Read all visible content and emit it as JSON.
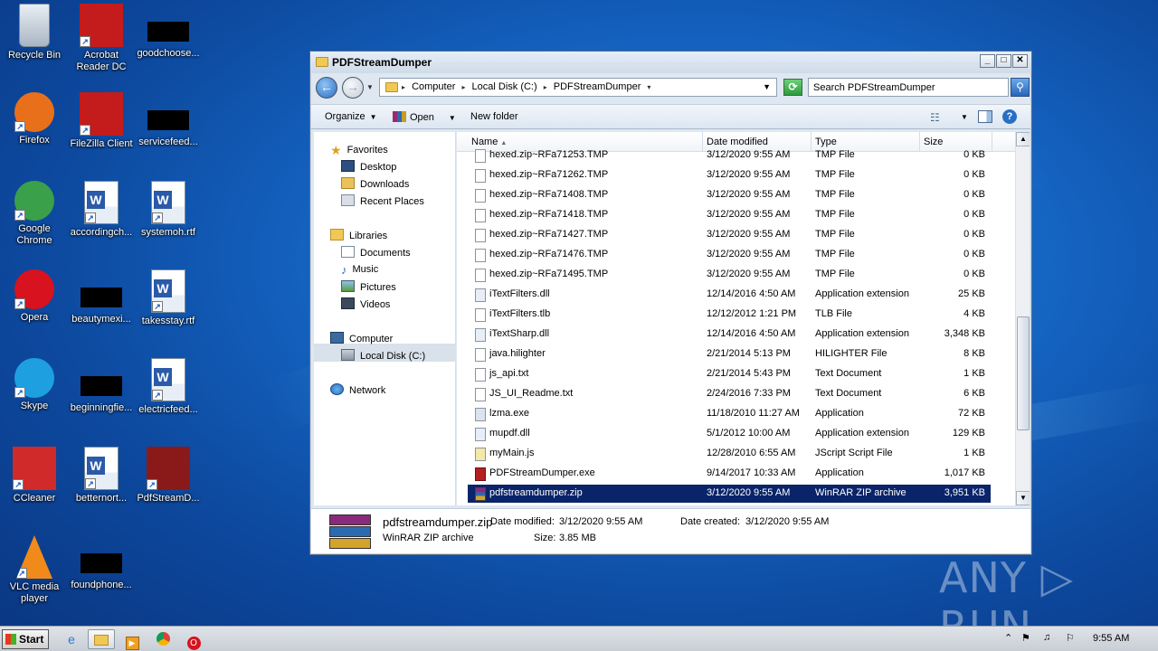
{
  "desktop": {
    "icons": [
      {
        "label": "Recycle Bin"
      },
      {
        "label": "Acrobat\nReader DC"
      },
      {
        "label": "goodchoose..."
      },
      {
        "label": "Firefox"
      },
      {
        "label": "FileZilla Client"
      },
      {
        "label": "servicefeed..."
      },
      {
        "label": "Google\nChrome"
      },
      {
        "label": "accordingch..."
      },
      {
        "label": "systemoh.rtf"
      },
      {
        "label": "Opera"
      },
      {
        "label": "beautymexi..."
      },
      {
        "label": "takesstay.rtf"
      },
      {
        "label": "Skype"
      },
      {
        "label": "beginningfie..."
      },
      {
        "label": "electricfeed..."
      },
      {
        "label": "CCleaner"
      },
      {
        "label": "betternort..."
      },
      {
        "label": "PdfStreamD..."
      },
      {
        "label": "VLC media\nplayer"
      },
      {
        "label": "foundphone..."
      }
    ],
    "watermark": "ANY ▷ RUN"
  },
  "window": {
    "title": "PDFStreamDumper",
    "controls": {
      "minimize": "_",
      "maximize": "□",
      "close": "✕"
    },
    "address": {
      "crumbs": [
        "Computer",
        "Local Disk (C:)",
        "PDFStreamDumper"
      ]
    },
    "search": {
      "placeholder": "Search PDFStreamDumper"
    },
    "toolbar": {
      "organize": "Organize",
      "open": "Open",
      "new_folder": "New folder"
    },
    "nav": {
      "favorites": "Favorites",
      "desktop": "Desktop",
      "downloads": "Downloads",
      "recent": "Recent Places",
      "libraries": "Libraries",
      "documents": "Documents",
      "music": "Music",
      "pictures": "Pictures",
      "videos": "Videos",
      "computer": "Computer",
      "local_disk": "Local Disk (C:)",
      "network": "Network"
    },
    "columns": {
      "name": "Name",
      "date": "Date modified",
      "type": "Type",
      "size": "Size"
    },
    "files": [
      {
        "name": "hexed.zip~RFa71253.TMP",
        "date": "3/12/2020 9:55 AM",
        "type": "TMP File",
        "size": "0 KB",
        "icon": "blank"
      },
      {
        "name": "hexed.zip~RFa71262.TMP",
        "date": "3/12/2020 9:55 AM",
        "type": "TMP File",
        "size": "0 KB",
        "icon": "blank"
      },
      {
        "name": "hexed.zip~RFa71408.TMP",
        "date": "3/12/2020 9:55 AM",
        "type": "TMP File",
        "size": "0 KB",
        "icon": "blank"
      },
      {
        "name": "hexed.zip~RFa71418.TMP",
        "date": "3/12/2020 9:55 AM",
        "type": "TMP File",
        "size": "0 KB",
        "icon": "blank"
      },
      {
        "name": "hexed.zip~RFa71427.TMP",
        "date": "3/12/2020 9:55 AM",
        "type": "TMP File",
        "size": "0 KB",
        "icon": "blank"
      },
      {
        "name": "hexed.zip~RFa71476.TMP",
        "date": "3/12/2020 9:55 AM",
        "type": "TMP File",
        "size": "0 KB",
        "icon": "blank"
      },
      {
        "name": "hexed.zip~RFa71495.TMP",
        "date": "3/12/2020 9:55 AM",
        "type": "TMP File",
        "size": "0 KB",
        "icon": "blank"
      },
      {
        "name": "iTextFilters.dll",
        "date": "12/14/2016 4:50 AM",
        "type": "Application extension",
        "size": "25 KB",
        "icon": "dll"
      },
      {
        "name": "iTextFilters.tlb",
        "date": "12/12/2012 1:21 PM",
        "type": "TLB File",
        "size": "4 KB",
        "icon": "blank"
      },
      {
        "name": "iTextSharp.dll",
        "date": "12/14/2016 4:50 AM",
        "type": "Application extension",
        "size": "3,348 KB",
        "icon": "dll"
      },
      {
        "name": "java.hilighter",
        "date": "2/21/2014 5:13 PM",
        "type": "HILIGHTER File",
        "size": "8 KB",
        "icon": "blank"
      },
      {
        "name": "js_api.txt",
        "date": "2/21/2014 5:43 PM",
        "type": "Text Document",
        "size": "1 KB",
        "icon": "blank"
      },
      {
        "name": "JS_UI_Readme.txt",
        "date": "2/24/2016 7:33 PM",
        "type": "Text Document",
        "size": "6 KB",
        "icon": "blank"
      },
      {
        "name": "lzma.exe",
        "date": "11/18/2010 11:27 AM",
        "type": "Application",
        "size": "72 KB",
        "icon": "exe"
      },
      {
        "name": "mupdf.dll",
        "date": "5/1/2012 10:00 AM",
        "type": "Application extension",
        "size": "129 KB",
        "icon": "dll"
      },
      {
        "name": "myMain.js",
        "date": "12/28/2010 6:55 AM",
        "type": "JScript Script File",
        "size": "1 KB",
        "icon": "js"
      },
      {
        "name": "PDFStreamDumper.exe",
        "date": "9/14/2017 10:33 AM",
        "type": "Application",
        "size": "1,017 KB",
        "icon": "pdf"
      },
      {
        "name": "pdfstreamdumper.zip",
        "date": "3/12/2020 9:55 AM",
        "type": "WinRAR ZIP archive",
        "size": "3,951 KB",
        "icon": "zip",
        "selected": true
      }
    ],
    "details": {
      "filename": "pdfstreamdumper.zip",
      "filetype": "WinRAR ZIP archive",
      "modified_label": "Date modified:",
      "modified": "3/12/2020 9:55 AM",
      "created_label": "Date created:",
      "created": "3/12/2020 9:55 AM",
      "size_label": "Size:",
      "size": "3.85 MB"
    }
  },
  "taskbar": {
    "start": "Start",
    "clock": "9:55 AM"
  }
}
